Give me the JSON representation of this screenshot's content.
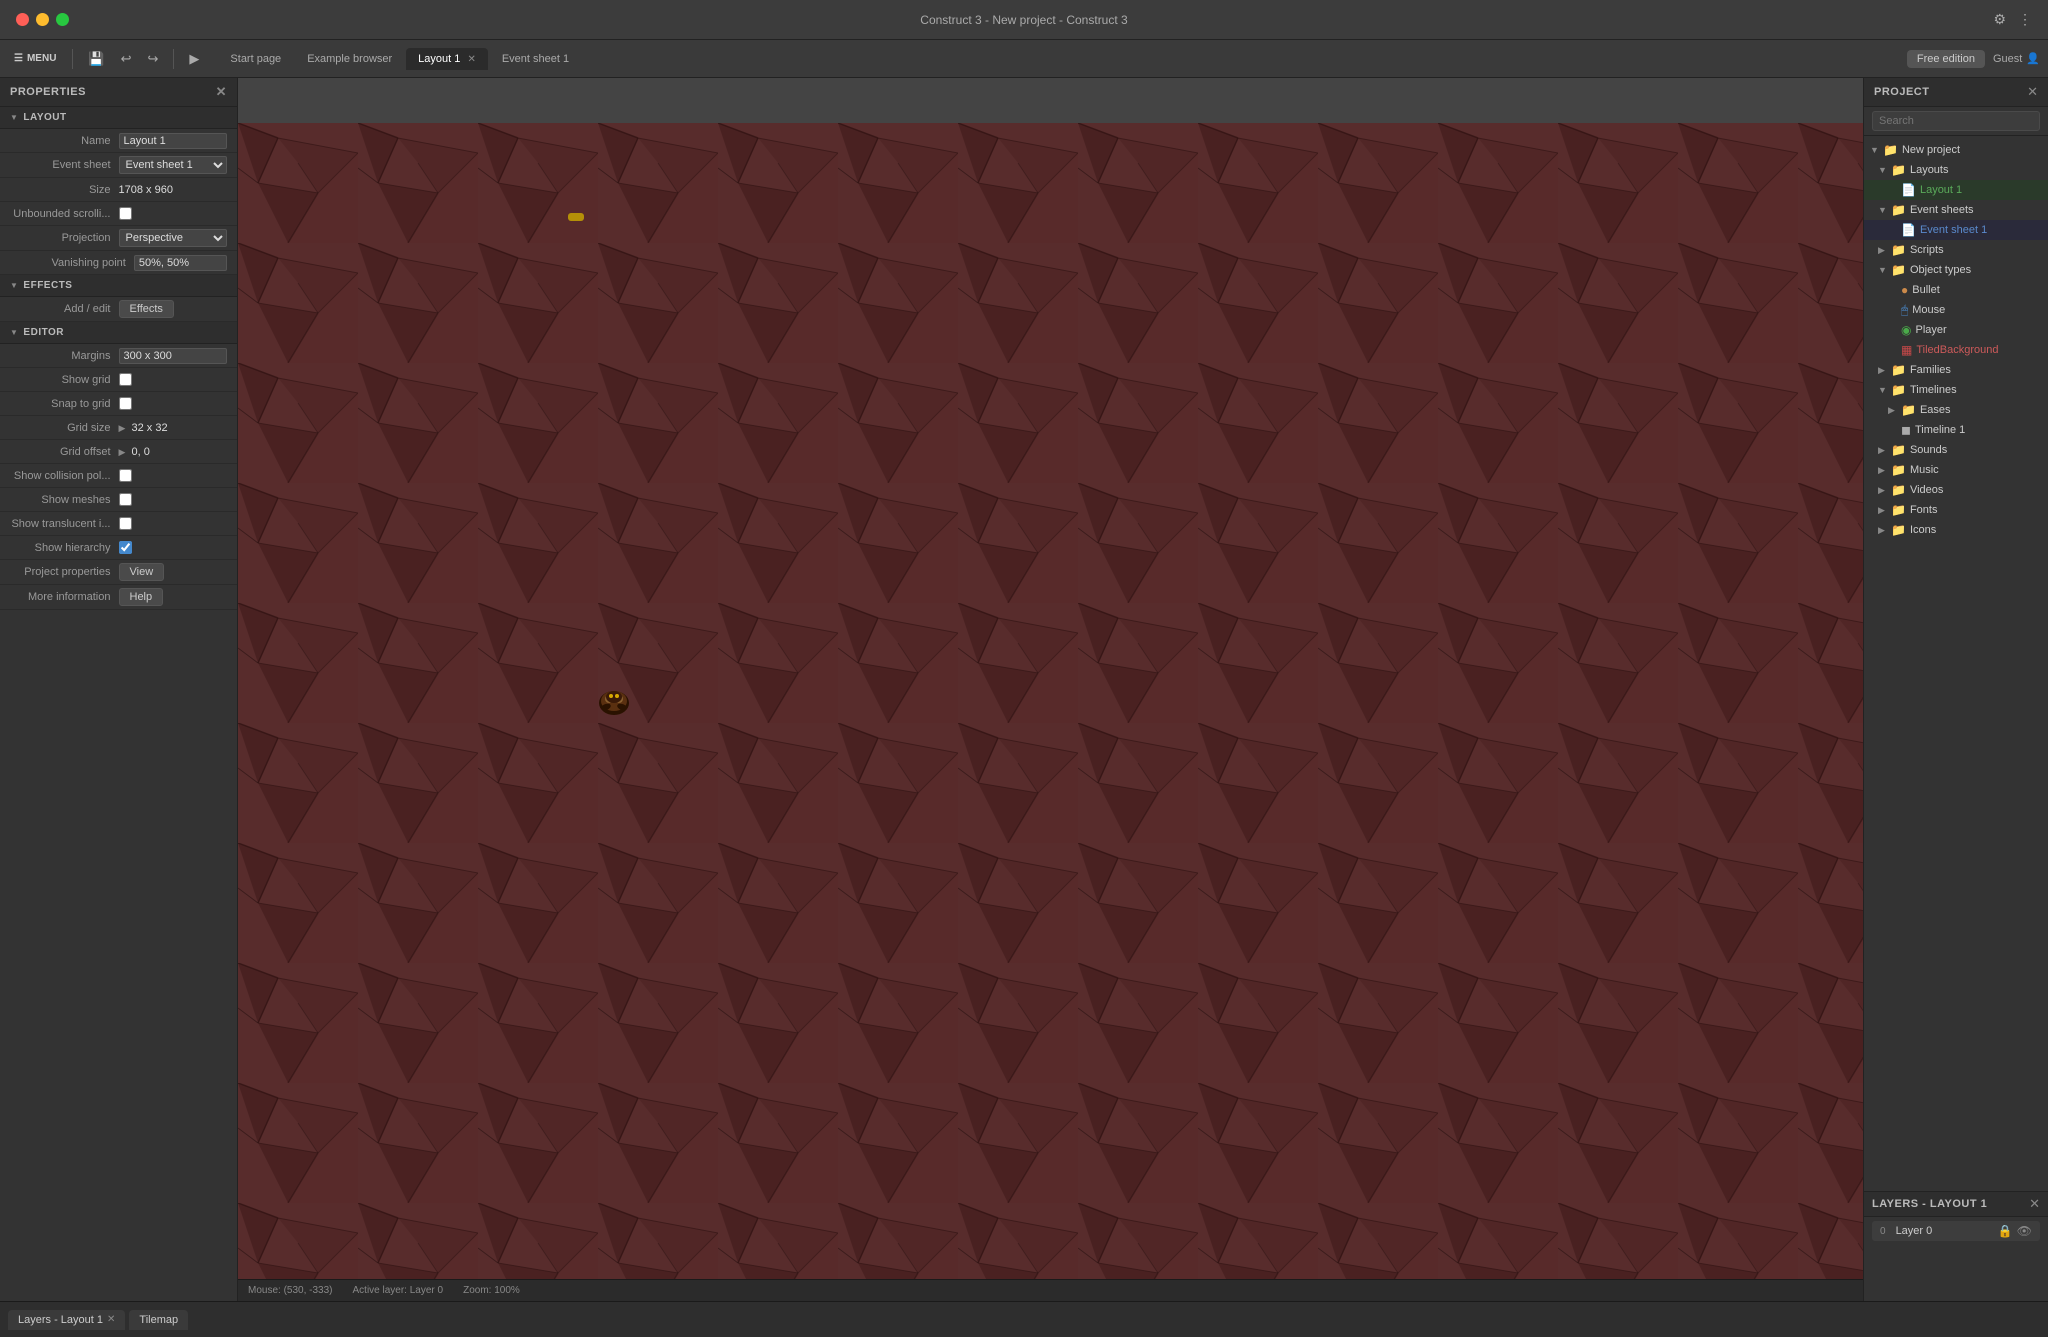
{
  "titlebar": {
    "title": "Construct 3 - New project - Construct 3",
    "traffic_lights": [
      "red",
      "yellow",
      "green"
    ]
  },
  "toolbar": {
    "menu_label": "MENU",
    "tabs": [
      {
        "id": "start-page",
        "label": "Start page",
        "active": false,
        "closeable": false
      },
      {
        "id": "example-browser",
        "label": "Example browser",
        "active": false,
        "closeable": false
      },
      {
        "id": "layout-1",
        "label": "Layout 1",
        "active": true,
        "closeable": true
      },
      {
        "id": "event-sheet-1",
        "label": "Event sheet 1",
        "active": false,
        "closeable": false
      }
    ],
    "free_edition": "Free edition",
    "guest": "Guest"
  },
  "properties": {
    "panel_title": "PROPERTIES",
    "sections": {
      "layout": {
        "title": "LAYOUT",
        "fields": {
          "name_label": "Name",
          "name_value": "Layout 1",
          "event_sheet_label": "Event sheet",
          "event_sheet_value": "Event sheet 1",
          "size_label": "Size",
          "size_value": "1708 x 960",
          "unbounded_scroll_label": "Unbounded scrolli...",
          "projection_label": "Projection",
          "projection_value": "Perspective",
          "vanishing_point_label": "Vanishing point",
          "vanishing_point_value": "50%, 50%"
        }
      },
      "effects": {
        "title": "EFFECTS",
        "add_edit_label": "Add / edit",
        "effects_btn": "Effects"
      },
      "editor": {
        "title": "EDITOR",
        "margins_label": "Margins",
        "margins_value": "300 x 300",
        "show_grid_label": "Show grid",
        "snap_to_grid_label": "Snap to grid",
        "grid_size_label": "Grid size",
        "grid_size_value": "32 x 32",
        "grid_offset_label": "Grid offset",
        "grid_offset_value": "0, 0",
        "show_collision_label": "Show collision pol...",
        "show_meshes_label": "Show meshes",
        "show_translucent_label": "Show translucent i...",
        "show_hierarchy_label": "Show hierarchy",
        "project_properties_label": "Project properties",
        "view_btn": "View",
        "more_information_label": "More information",
        "help_btn": "Help"
      }
    }
  },
  "project": {
    "panel_title": "PROJECT",
    "search_placeholder": "Search",
    "tree": [
      {
        "level": 0,
        "type": "folder",
        "label": "New project",
        "expanded": true
      },
      {
        "level": 1,
        "type": "folder",
        "label": "Layouts",
        "expanded": true
      },
      {
        "level": 2,
        "type": "file",
        "label": "Layout 1",
        "color": "green",
        "active": true
      },
      {
        "level": 1,
        "type": "folder",
        "label": "Event sheets",
        "expanded": true
      },
      {
        "level": 2,
        "type": "file",
        "label": "Event sheet 1",
        "color": "blue",
        "active": true
      },
      {
        "level": 1,
        "type": "folder",
        "label": "Scripts",
        "expanded": false
      },
      {
        "level": 1,
        "type": "folder",
        "label": "Object types",
        "expanded": true
      },
      {
        "level": 2,
        "type": "file",
        "label": "Bullet",
        "color": "orange"
      },
      {
        "level": 2,
        "type": "file",
        "label": "Mouse",
        "color": "blue"
      },
      {
        "level": 2,
        "type": "file",
        "label": "Player",
        "color": "green"
      },
      {
        "level": 2,
        "type": "file",
        "label": "TiledBackground",
        "color": "red"
      },
      {
        "level": 1,
        "type": "folder",
        "label": "Families",
        "expanded": false
      },
      {
        "level": 1,
        "type": "folder",
        "label": "Timelines",
        "expanded": true
      },
      {
        "level": 2,
        "type": "folder",
        "label": "Eases",
        "expanded": false
      },
      {
        "level": 2,
        "type": "file",
        "label": "Timeline 1",
        "color": ""
      },
      {
        "level": 1,
        "type": "folder",
        "label": "Sounds",
        "expanded": false
      },
      {
        "level": 1,
        "type": "folder",
        "label": "Music",
        "expanded": false
      },
      {
        "level": 1,
        "type": "folder",
        "label": "Videos",
        "expanded": false
      },
      {
        "level": 1,
        "type": "folder",
        "label": "Fonts",
        "expanded": false
      },
      {
        "level": 1,
        "type": "folder",
        "label": "Icons",
        "expanded": false
      }
    ]
  },
  "layers": {
    "panel_title": "LAYERS - LAYOUT 1",
    "items": [
      {
        "num": "0",
        "label": "Layer 0"
      }
    ]
  },
  "canvas": {
    "status": {
      "mouse": "Mouse: (530, -333)",
      "active_layer": "Active layer: Layer 0",
      "zoom": "Zoom: 100%"
    }
  },
  "bottom_tabs": [
    {
      "label": "Layers - Layout 1",
      "closeable": true
    },
    {
      "label": "Tilemap",
      "closeable": false
    }
  ]
}
